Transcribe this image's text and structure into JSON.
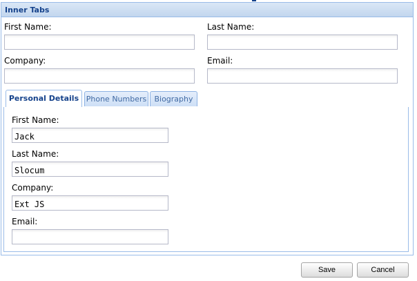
{
  "panel": {
    "title": "Inner Tabs"
  },
  "top_form": {
    "first_name": {
      "label": "First Name:",
      "value": ""
    },
    "last_name": {
      "label": "Last Name:",
      "value": ""
    },
    "company": {
      "label": "Company:",
      "value": ""
    },
    "email": {
      "label": "Email:",
      "value": ""
    }
  },
  "tabs": [
    {
      "label": "Personal Details",
      "active": true
    },
    {
      "label": "Phone Numbers",
      "active": false
    },
    {
      "label": "Biography",
      "active": false
    }
  ],
  "personal_details": {
    "first_name": {
      "label": "First Name:",
      "value": "Jack"
    },
    "last_name": {
      "label": "Last Name:",
      "value": "Slocum"
    },
    "company": {
      "label": "Company:",
      "value": "Ext JS"
    },
    "email": {
      "label": "Email:",
      "value": ""
    }
  },
  "buttons": {
    "save": "Save",
    "cancel": "Cancel"
  },
  "colors": {
    "header_text": "#15428b",
    "border": "#99bbe8",
    "tab_inactive_text": "#416aa3"
  }
}
